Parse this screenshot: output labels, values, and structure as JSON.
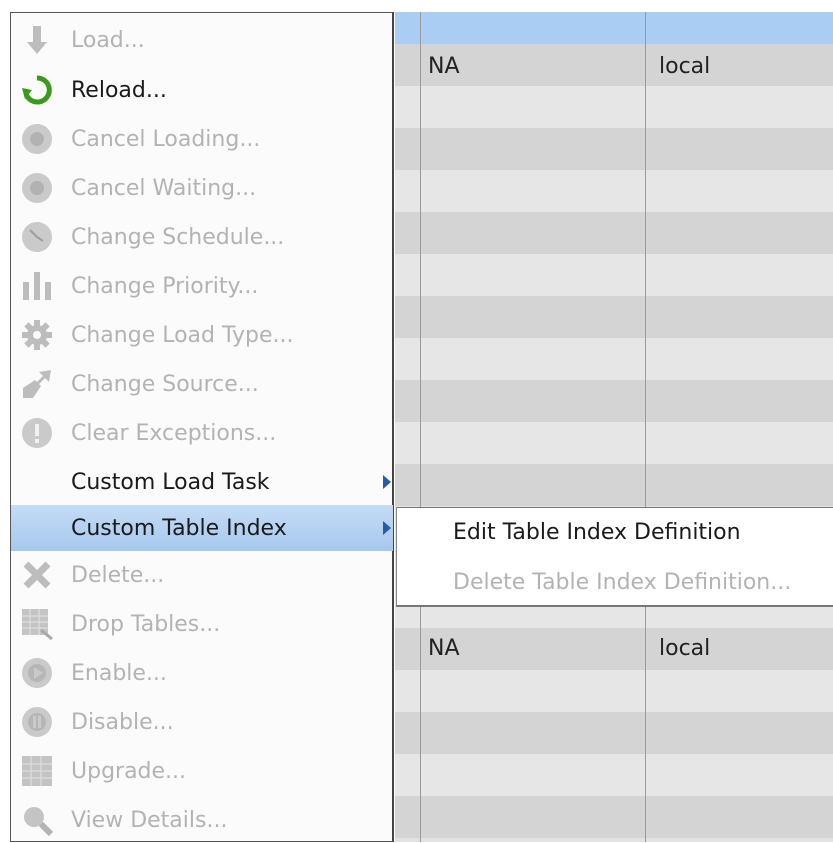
{
  "menu": {
    "items": [
      {
        "label": "Load...",
        "icon": "down-arrow-icon",
        "enabled": false
      },
      {
        "label": "Reload...",
        "icon": "reload-icon",
        "enabled": true
      },
      {
        "label": "Cancel Loading...",
        "icon": "cancel-loading-icon",
        "enabled": false
      },
      {
        "label": "Cancel Waiting...",
        "icon": "cancel-waiting-icon",
        "enabled": false
      },
      {
        "label": "Change Schedule...",
        "icon": "clock-icon",
        "enabled": false
      },
      {
        "label": "Change Priority...",
        "icon": "priority-icon",
        "enabled": false
      },
      {
        "label": "Change Load Type...",
        "icon": "gear-icon",
        "enabled": false
      },
      {
        "label": "Change Source...",
        "icon": "source-icon",
        "enabled": false
      },
      {
        "label": "Clear Exceptions...",
        "icon": "exclamation-icon",
        "enabled": false
      },
      {
        "label": "Custom Load Task",
        "icon": "",
        "enabled": true,
        "submenu": true
      },
      {
        "label": "Custom Table Index",
        "icon": "",
        "enabled": true,
        "submenu": true,
        "highlighted": true
      },
      {
        "label": "Delete...",
        "icon": "delete-x-icon",
        "enabled": false
      },
      {
        "label": "Drop Tables...",
        "icon": "drop-tables-icon",
        "enabled": false
      },
      {
        "label": "Enable...",
        "icon": "play-icon",
        "enabled": false
      },
      {
        "label": "Disable...",
        "icon": "pause-icon",
        "enabled": false
      },
      {
        "label": "Upgrade...",
        "icon": "upgrade-icon",
        "enabled": false
      },
      {
        "label": "View Details...",
        "icon": "magnifier-icon",
        "enabled": false
      }
    ]
  },
  "submenu": {
    "items": [
      {
        "label": "Edit Table Index Definition",
        "enabled": true
      },
      {
        "label": "Delete Table Index Definition...",
        "enabled": false
      }
    ]
  },
  "grid": {
    "rows": [
      {
        "col1": "NA",
        "col2": "local"
      },
      {
        "col1": "NA",
        "col2": "local"
      }
    ]
  },
  "colors": {
    "highlight": "#a6c8ee",
    "selected_row": "#a9cdf3",
    "disabled_text": "#b3b3b3",
    "reload_icon": "#3a9a1a",
    "submenu_arrow": "#2a5aa6"
  }
}
